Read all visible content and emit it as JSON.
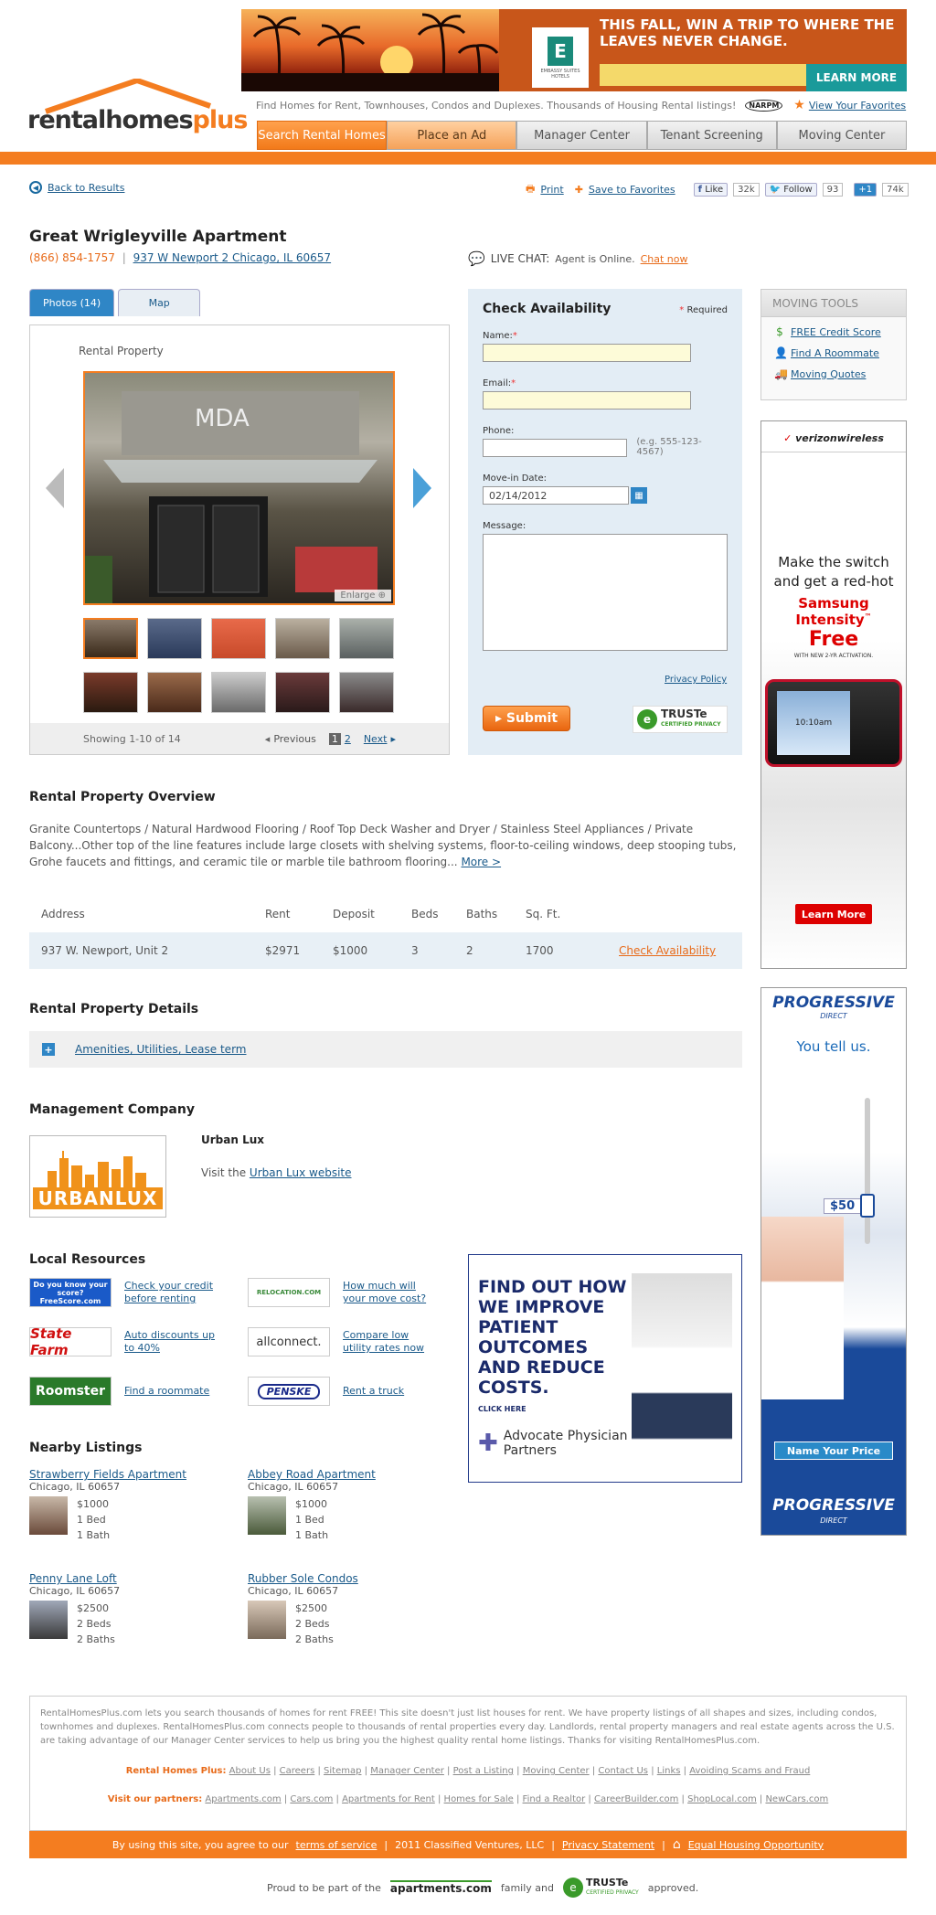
{
  "header": {
    "logo_text": "rentalhomesplus",
    "tagline": "Find Homes for Rent, Townhouses, Condos and Duplexes. Thousands of Housing Rental listings!",
    "narpm": "NARPM",
    "favorites": "View Your Favorites",
    "nav": [
      {
        "label": "Search Rental Homes"
      },
      {
        "label": "Place an Ad"
      },
      {
        "label": "Manager Center"
      },
      {
        "label": "Tenant Screening"
      },
      {
        "label": "Moving Center"
      }
    ]
  },
  "banner_ad": {
    "headline": "THIS FALL, WIN A TRIP TO WHERE THE LEAVES NEVER CHANGE.",
    "brand": "EMBASSY SUITES HOTELS",
    "cta": "LEARN MORE"
  },
  "toolbar": {
    "back": "Back to Results",
    "print": "Print",
    "save": "Save to Favorites",
    "like": "Like",
    "like_count": "32k",
    "follow": "Follow",
    "follow_count": "93",
    "plus": "+1",
    "plus_count": "74k"
  },
  "listing": {
    "title": "Great Wrigleyville Apartment",
    "phone": "(866) 854-1757",
    "address": "937 W Newport 2 Chicago, IL 60657",
    "live_chat_label": "LIVE CHAT:",
    "live_chat_status": "Agent is Online.",
    "chat_now": "Chat now"
  },
  "photos": {
    "tab_photos": "Photos (14)",
    "tab_map": "Map",
    "label": "Rental Property",
    "enlarge": "Enlarge",
    "showing": "Showing 1-10 of 14",
    "previous": "Previous",
    "page1": "1",
    "page2": "2",
    "next": "Next"
  },
  "form": {
    "title": "Check Availability",
    "required": "Required",
    "name_label": "Name:",
    "email_label": "Email:",
    "phone_label": "Phone:",
    "phone_hint": "(e.g. 555-123-4567)",
    "movein_label": "Move-in Date:",
    "movein_value": "02/14/2012",
    "message_label": "Message:",
    "privacy": "Privacy Policy",
    "submit": "Submit",
    "truste": "TRUSTe",
    "truste_sub": "CERTIFIED PRIVACY"
  },
  "tools": {
    "head": "MOVING TOOLS",
    "items": [
      "FREE Credit Score",
      "Find A Roommate",
      "Moving Quotes"
    ]
  },
  "verizon_ad": {
    "brand": "verizonwireless",
    "line1": "Make the switch and get a red-hot",
    "phone": "Samsung Intensity",
    "tm": "™",
    "free": "Free",
    "fine": "WITH NEW 2-YR ACTIVATION.",
    "clock": "10:10am",
    "cta": "Learn More"
  },
  "progressive_ad": {
    "brand": "PROGRESSIVE",
    "brand_sub": "DIRECT",
    "line": "You tell us.",
    "price": "$50",
    "cta": "Name Your Price"
  },
  "overview": {
    "heading": "Rental Property Overview",
    "desc": "Granite Countertops / Natural Hardwood Flooring / Roof Top Deck Washer and Dryer / Stainless Steel Appliances / Private Balcony...Other top of the line features include large closets with shelving systems, floor-to-ceiling windows, deep stooping tubs, Grohe faucets and fittings, and ceramic tile or marble tile bathroom flooring...",
    "more": "More >",
    "columns": [
      "Address",
      "Rent",
      "Deposit",
      "Beds",
      "Baths",
      "Sq. Ft."
    ],
    "rows": [
      {
        "address": "937 W. Newport, Unit 2",
        "rent": "$2971",
        "deposit": "$1000",
        "beds": "3",
        "baths": "2",
        "sqft": "1700",
        "action": "Check Availability"
      }
    ]
  },
  "details": {
    "heading": "Rental Property Details",
    "link": "Amenities, Utilities, Lease term"
  },
  "management": {
    "heading": "Management Company",
    "logo_text": "URBANLUX",
    "name": "Urban Lux",
    "visit_prefix": "Visit the",
    "visit_link": "Urban Lux website"
  },
  "resources": {
    "heading": "Local Resources",
    "items": [
      {
        "logo": "Do you know your score? FreeScore.com",
        "link": "Check your credit before renting"
      },
      {
        "logo": "RELOCATION.COM",
        "link": "How much will your move cost?"
      },
      {
        "logo": "State Farm",
        "link": "Auto discounts up to 40%"
      },
      {
        "logo": "allconnect.",
        "link": "Compare low utility rates now"
      },
      {
        "logo": "Roomster",
        "link": "Find a roommate"
      },
      {
        "logo": "PENSKE",
        "link": "Rent a truck"
      }
    ]
  },
  "advocate_ad": {
    "headline": "FIND OUT HOW WE IMPROVE PATIENT OUTCOMES AND REDUCE COSTS.",
    "click": "CLICK HERE",
    "brand": "Advocate Physician Partners"
  },
  "nearby": {
    "heading": "Nearby Listings",
    "items": [
      {
        "title": "Strawberry Fields Apartment",
        "city": "Chicago, IL 60657",
        "price": "$1000",
        "beds": "1 Bed",
        "baths": "1 Bath"
      },
      {
        "title": "Abbey Road Apartment",
        "city": "Chicago, IL 60657",
        "price": "$1000",
        "beds": "1 Bed",
        "baths": "1 Bath"
      },
      {
        "title": "Penny Lane Loft",
        "city": "Chicago, IL 60657",
        "price": "$2500",
        "beds": "2 Beds",
        "baths": "2 Baths"
      },
      {
        "title": "Rubber Sole Condos",
        "city": "Chicago, IL 60657",
        "price": "$2500",
        "beds": "2 Beds",
        "baths": "2 Baths"
      }
    ]
  },
  "footer": {
    "about": "RentalHomesPlus.com lets you search thousands of homes for rent FREE! This site doesn't just list houses for rent. We have property listings of all shapes and sizes, including condos, townhomes and duplexes. RentalHomesPlus.com connects people to thousands of rental properties every day. Landlords, rental property managers and real estate agents across the U.S. are taking advantage of our Manager Center services to help us bring you the highest quality rental home listings. Thanks for visiting RentalHomesPlus.com.",
    "links_label": "Rental Homes Plus:",
    "links": [
      "About Us",
      "Careers",
      "Sitemap",
      "Manager Center",
      "Post a Listing",
      "Moving Center",
      "Contact Us",
      "Links",
      "Avoiding Scams and Fraud"
    ],
    "partners_label": "Visit our partners:",
    "partners": [
      "Apartments.com",
      "Cars.com",
      "Apartments for Rent",
      "Homes for Sale",
      "Find a Realtor",
      "CareerBuilder.com",
      "ShopLocal.com",
      "NewCars.com"
    ],
    "agree": "By using this site, you agree to our",
    "tos": "terms of service",
    "copyright": "2011 Classified Ventures, LLC",
    "privacy": "Privacy Statement",
    "eho": "Equal Housing Opportunity",
    "proud": "Proud to be part of the",
    "apartments": "apartments.com",
    "family": "family and",
    "truste": "TRUSTe",
    "truste_sub": "CERTIFIED PRIVACY",
    "approved": "approved."
  }
}
